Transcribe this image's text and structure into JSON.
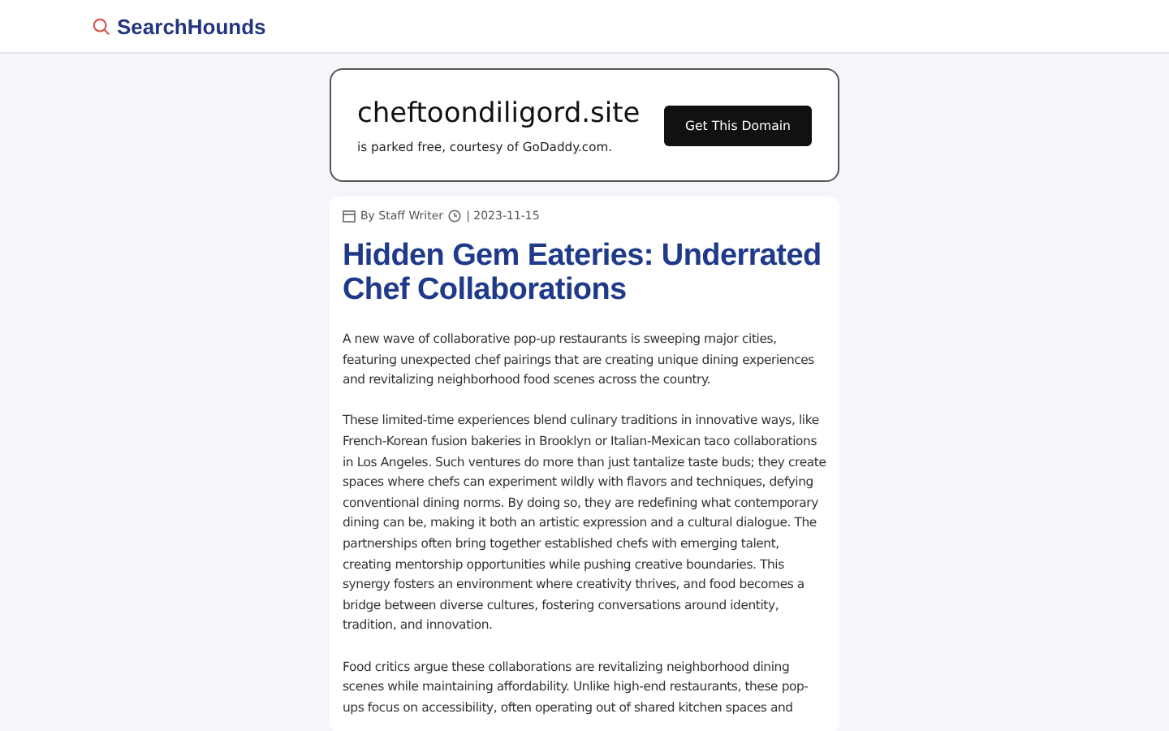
{
  "header": {
    "brand": "SearchHounds"
  },
  "domain_banner": {
    "domain": "cheftoondiligord.site",
    "note": "is parked free, courtesy of GoDaddy.com.",
    "button": "Get This Domain"
  },
  "article": {
    "author": "By Staff Writer",
    "date": "| 2023-11-15",
    "title": "Hidden Gem Eateries: Underrated Chef Collaborations",
    "paragraphs": [
      "A new wave of collaborative pop-up restaurants is sweeping major cities, featuring unexpected chef pairings that are creating unique dining experiences and revitalizing neighborhood food scenes across the country.",
      "These limited-time experiences blend culinary traditions in innovative ways, like French-Korean fusion bakeries in Brooklyn or Italian-Mexican taco collaborations in Los Angeles. Such ventures do more than just tantalize taste buds; they create spaces where chefs can experiment wildly with flavors and techniques, defying conventional dining norms. By doing so, they are redefining what contemporary dining can be, making it both an artistic expression and a cultural dialogue. The partnerships often bring together established chefs with emerging talent, creating mentorship opportunities while pushing creative boundaries. This synergy fosters an environment where creativity thrives, and food becomes a bridge between diverse cultures, fostering conversations around identity, tradition, and innovation.",
      "Food critics argue these collaborations are revitalizing neighborhood dining scenes while maintaining affordability. Unlike high-end restaurants, these pop-ups focus on accessibility, often operating out of shared kitchen spaces and"
    ]
  }
}
